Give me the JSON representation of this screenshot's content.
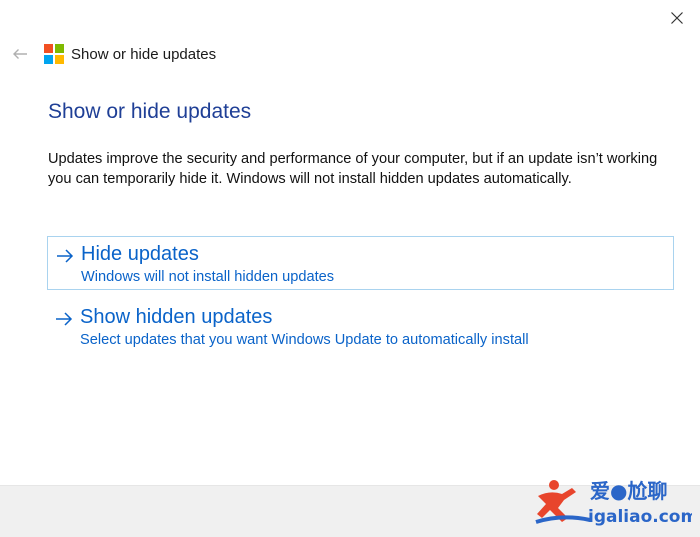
{
  "window": {
    "title": "Show or hide updates"
  },
  "icons": {
    "close": "close-icon",
    "back": "back-arrow-icon",
    "logo": "windows-logo-icon",
    "option_arrow": "arrow-right-icon"
  },
  "colors": {
    "heading": "#1f3f96",
    "link": "#0a63c9",
    "selected_border": "#a9d3ef",
    "footer": "#f0f0f0",
    "logo_red": "#f25022",
    "logo_green": "#7fba00",
    "logo_blue": "#00a4ef",
    "logo_yellow": "#ffb900"
  },
  "main": {
    "heading": "Show or hide updates",
    "description": "Updates improve the security and performance of your computer, but if an update isn’t working you can temporarily hide it. Windows will not install hidden updates automatically.",
    "options": [
      {
        "title": "Hide updates",
        "subtitle": "Windows will not install hidden updates",
        "selected": true
      },
      {
        "title": "Show hidden updates",
        "subtitle": "Select updates that you want Windows Update to automatically install",
        "selected": false
      }
    ]
  },
  "watermark": {
    "line1": "爱●尬聊",
    "line2": "igaliao.com"
  }
}
